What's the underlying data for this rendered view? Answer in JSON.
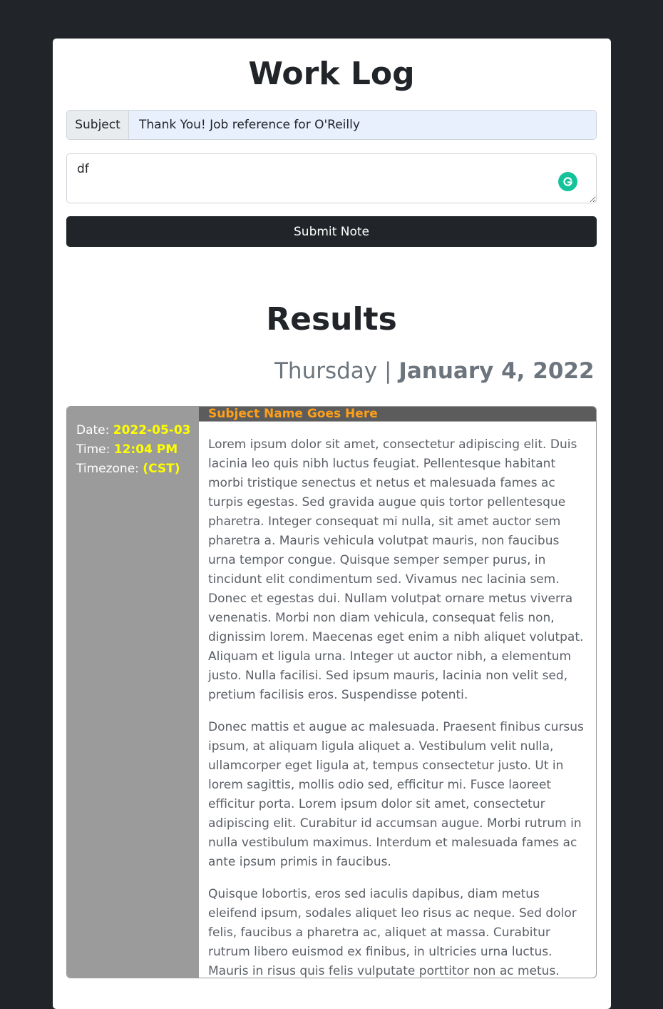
{
  "header": {
    "title": "Work Log"
  },
  "form": {
    "subject_label": "Subject",
    "subject_value": "Thank You! Job reference for O'Reilly",
    "note_value": "df",
    "submit_label": "Submit Note"
  },
  "results": {
    "heading": "Results",
    "day": "Thursday",
    "separator": " | ",
    "date": "January 4, 2022"
  },
  "entry": {
    "date_label": "Date: ",
    "date_value": "2022-05-03",
    "time_label": "Time: ",
    "time_value": "12:04 PM",
    "timezone_label": "Timezone: ",
    "timezone_value": "(CST)",
    "subject": "Subject Name Goes Here",
    "paragraphs": [
      "Lorem ipsum dolor sit amet, consectetur adipiscing elit. Duis lacinia leo quis nibh luctus feugiat. Pellentesque habitant morbi tristique senectus et netus et malesuada fames ac turpis egestas. Sed gravida augue quis tortor pellentesque pharetra. Integer consequat mi nulla, sit amet auctor sem pharetra a. Mauris vehicula volutpat mauris, non faucibus urna tempor congue. Quisque semper semper purus, in tincidunt elit condimentum sed. Vivamus nec lacinia sem. Donec et egestas dui. Nullam volutpat ornare metus viverra venenatis. Morbi non diam vehicula, consequat felis non, dignissim lorem. Maecenas eget enim a nibh aliquet volutpat. Aliquam et ligula urna. Integer ut auctor nibh, a elementum justo. Nulla facilisi. Sed ipsum mauris, lacinia non velit sed, pretium facilisis eros. Suspendisse potenti.",
      "Donec mattis et augue ac malesuada. Praesent finibus cursus ipsum, at aliquam ligula aliquet a. Vestibulum velit nulla, ullamcorper eget ligula at, tempus consectetur justo. Ut in lorem sagittis, mollis odio sed, efficitur mi. Fusce laoreet efficitur porta. Lorem ipsum dolor sit amet, consectetur adipiscing elit. Curabitur id accumsan augue. Morbi rutrum in nulla vestibulum maximus. Interdum et malesuada fames ac ante ipsum primis in faucibus.",
      "Quisque lobortis, eros sed iaculis dapibus, diam metus eleifend ipsum, sodales aliquet leo risus ac neque. Sed dolor felis, faucibus a pharetra ac, aliquet at massa. Curabitur rutrum libero euismod ex finibus, in ultricies urna luctus. Mauris in risus quis felis vulputate porttitor non ac metus. Maecenas in enim quam."
    ]
  },
  "icons": {
    "grammarly": "grammarly-icon"
  },
  "colors": {
    "page_bg": "#212529",
    "accent_yellow": "#ffff00",
    "subject_orange": "#ff9f1a",
    "sidebar_gray": "#9b9b9b"
  }
}
